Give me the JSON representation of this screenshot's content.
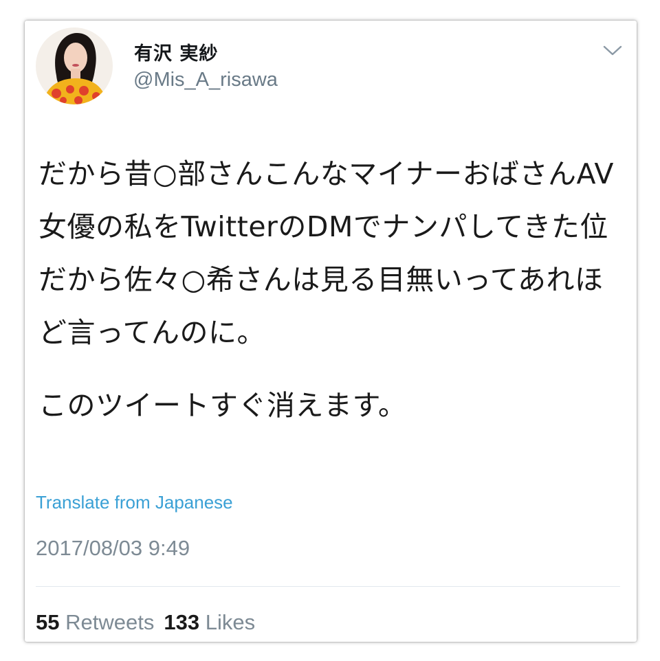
{
  "tweet": {
    "author": {
      "display_name": "有沢 実紗",
      "handle": "@Mis_A_risawa"
    },
    "menu_icon": "chevron-down-icon",
    "text_paragraphs": [
      "だから昔○部さんこんなマイナーおばさんAV女優の私をTwitterのDMでナンパしてきた位だから佐々○希さんは見る目無いってあれほど言ってんのに。",
      "このツイートすぐ消えます。"
    ],
    "translate_label": "Translate from Japanese",
    "timestamp": "2017/08/03 9:49",
    "stats": {
      "retweets_count": "55",
      "retweets_label": "Retweets",
      "likes_count": "133",
      "likes_label": "Likes"
    }
  },
  "colors": {
    "link": "#3aa0d5",
    "secondary_text": "#7d8a94",
    "primary_text": "#14171a"
  }
}
